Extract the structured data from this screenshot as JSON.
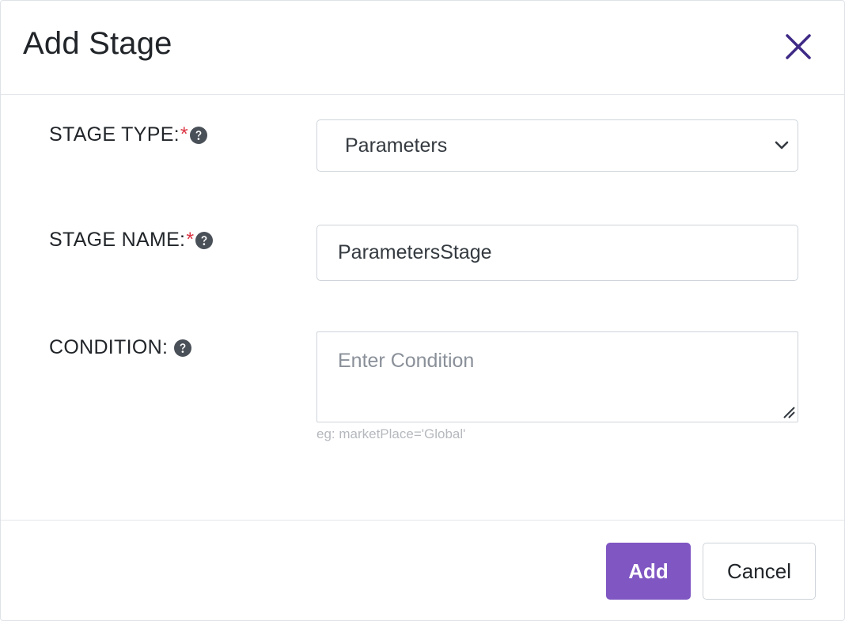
{
  "dialog": {
    "title": "Add Stage",
    "close_icon": "close-icon"
  },
  "form": {
    "stage_type": {
      "label": "STAGE TYPE:",
      "required_mark": "*",
      "help_icon": "question-circle-icon",
      "value": "Parameters"
    },
    "stage_name": {
      "label": "STAGE NAME:",
      "required_mark": "*",
      "help_icon": "question-circle-icon",
      "value": "ParametersStage"
    },
    "condition": {
      "label": "CONDITION:",
      "help_icon": "question-circle-icon",
      "placeholder": "Enter Condition",
      "value": "",
      "hint": "eg: marketPlace='Global'"
    }
  },
  "footer": {
    "add_label": "Add",
    "cancel_label": "Cancel"
  },
  "colors": {
    "primary": "#7f56c2",
    "close_icon": "#3f2a86",
    "required": "#dc3545",
    "help_icon": "#4a5058"
  }
}
